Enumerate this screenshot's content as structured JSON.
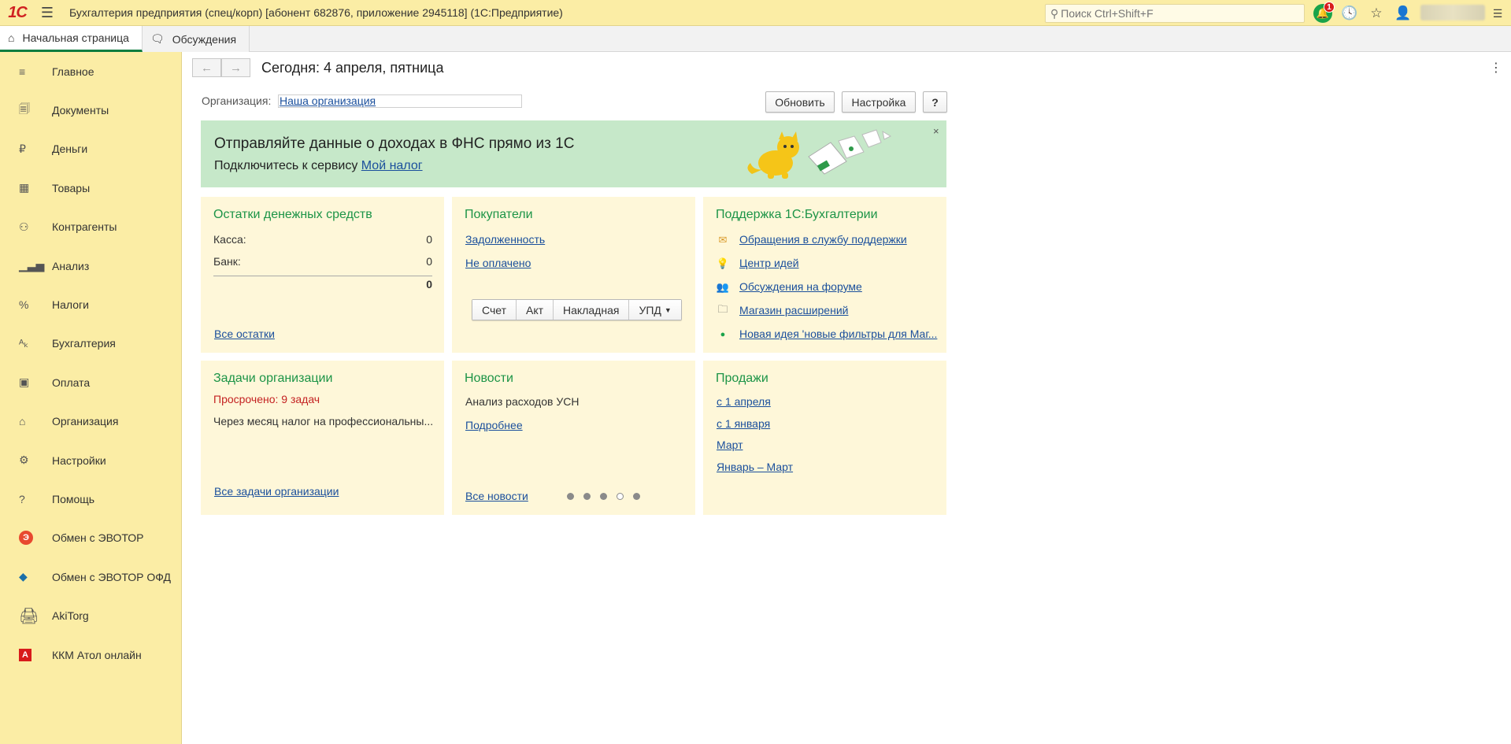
{
  "app": {
    "logo": "1С",
    "title": "Бухгалтерия предприятия (спец/корп) [абонент 682876, приложение 2945118]  (1С:Предприятие)",
    "search_placeholder": "Поиск Ctrl+Shift+F",
    "notifications_count": "1"
  },
  "tabs": [
    {
      "label": "Начальная страница",
      "icon": "home-icon",
      "active": true
    },
    {
      "label": "Обсуждения",
      "icon": "chat-icon",
      "active": false
    }
  ],
  "sidebar": {
    "items": [
      {
        "label": "Главное",
        "icon": "list-icon"
      },
      {
        "label": "Документы",
        "icon": "documents-icon"
      },
      {
        "label": "Деньги",
        "icon": "ruble-icon"
      },
      {
        "label": "Товары",
        "icon": "goods-icon"
      },
      {
        "label": "Контрагенты",
        "icon": "contractors-icon"
      },
      {
        "label": "Анализ",
        "icon": "analysis-icon"
      },
      {
        "label": "Налоги",
        "icon": "percent-icon"
      },
      {
        "label": "Бухгалтерия",
        "icon": "accounting-icon"
      },
      {
        "label": "Оплата",
        "icon": "payment-icon"
      },
      {
        "label": "Организация",
        "icon": "organization-icon"
      },
      {
        "label": "Настройки",
        "icon": "gear-icon"
      },
      {
        "label": "Помощь",
        "icon": "question-icon"
      },
      {
        "label": "Обмен с ЭВОТОР",
        "icon": "evotor-icon"
      },
      {
        "label": "Обмен с ЭВОТОР ОФД",
        "icon": "evotor-ofd-icon"
      },
      {
        "label": "AkiTorg",
        "icon": "akitorg-icon"
      },
      {
        "label": "ККМ Атол онлайн",
        "icon": "atol-icon"
      }
    ]
  },
  "main": {
    "title": "Сегодня: 4 апреля, пятница",
    "org_label": "Организация:",
    "org_value": "Наша организация",
    "buttons": {
      "refresh": "Обновить",
      "settings": "Настройка",
      "help": "?"
    },
    "banner": {
      "heading": "Отправляйте данные о доходах в ФНС прямо из 1С",
      "sub_text": "Подключитесь к сервису ",
      "sub_link": "Мой налог",
      "close": "×"
    },
    "cash": {
      "title": "Остатки денежных средств",
      "rows": [
        {
          "label": "Касса:",
          "value": "0"
        },
        {
          "label": "Банк:",
          "value": "0"
        }
      ],
      "total": "0",
      "link": "Все остатки"
    },
    "buyers": {
      "title": "Покупатели",
      "links": [
        "Задолженность",
        "Не оплачено"
      ],
      "seg_buttons": [
        "Счет",
        "Акт",
        "Накладная",
        "УПД"
      ]
    },
    "support": {
      "title": "Поддержка 1С:Бухгалтерии",
      "items": [
        {
          "label": "Обращения в службу поддержки",
          "icon": "envelope-icon"
        },
        {
          "label": "Центр идей",
          "icon": "lightbulb-icon"
        },
        {
          "label": "Обсуждения на форуме",
          "icon": "forum-icon"
        },
        {
          "label": "Магазин расширений",
          "icon": "folder-add-icon"
        },
        {
          "label": "Новая идея 'новые фильтры для Маг...",
          "icon": "green-dot-icon"
        }
      ]
    },
    "tasks": {
      "title": "Задачи организации",
      "overdue": "Просрочено: 9 задач",
      "text": "Через месяц налог на профессиональны...",
      "link": "Все задачи организации"
    },
    "news": {
      "title": "Новости",
      "text": "Анализ расходов УСН",
      "more": "Подробнее",
      "all": "Все новости",
      "pager_active": 4,
      "pager_total": 5
    },
    "sales": {
      "title": "Продажи",
      "links": [
        "с 1 апреля",
        "с 1 января",
        "Март",
        "Январь – Март"
      ]
    }
  },
  "colors": {
    "sidebar_bg": "#fbeda5",
    "card_bg": "#fef7d9",
    "banner_bg": "#c6e8c9",
    "accent_green": "#1c9447",
    "link": "#1a4f9c",
    "alert_red": "#c42222"
  }
}
